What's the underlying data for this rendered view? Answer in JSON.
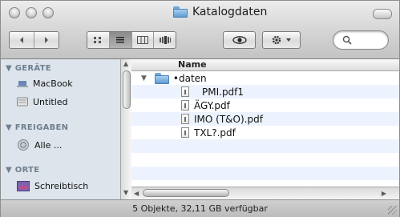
{
  "window": {
    "title": "Katalogdaten"
  },
  "toolbar": {
    "back_icon": "chevron-left-icon",
    "forward_icon": "chevron-right-icon",
    "views": [
      "icon-view-icon",
      "list-view-icon",
      "column-view-icon",
      "coverflow-view-icon"
    ],
    "eye_icon": "eye-icon",
    "action_icon": "gear-icon"
  },
  "sidebar": {
    "sections": [
      {
        "header": "GERÄTE",
        "items": [
          "MacBook",
          "Untitled"
        ]
      },
      {
        "header": "FREIGABEN",
        "items": [
          "Alle ..."
        ]
      },
      {
        "header": "ORTE",
        "items": [
          "Schreibtisch"
        ]
      }
    ]
  },
  "list": {
    "column_name": "Name",
    "folder": "•daten",
    "files": [
      "PMI.pdf1",
      "ÄGY.pdf",
      "IMO (T&O).pdf",
      "TXL?.pdf"
    ]
  },
  "status": {
    "text": "5 Objekte, 32,11 GB verfügbar"
  }
}
